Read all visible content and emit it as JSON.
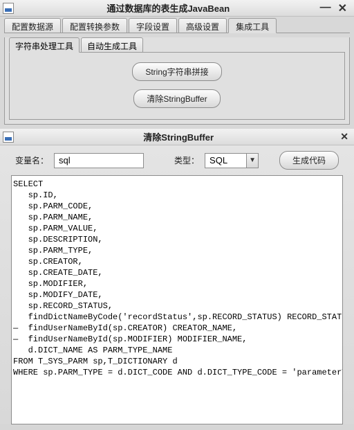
{
  "title": "通过数据库的表生成JavaBean",
  "window_buttons": {
    "min": "—",
    "close": "✕"
  },
  "main_tabs": [
    {
      "label": "配置数据源",
      "active": false
    },
    {
      "label": "配置转换参数",
      "active": false
    },
    {
      "label": "字段设置",
      "active": false
    },
    {
      "label": "高级设置",
      "active": false
    },
    {
      "label": "集成工具",
      "active": true
    }
  ],
  "sub_tabs": [
    {
      "label": "字符串处理工具",
      "active": true
    },
    {
      "label": "自动生成工具",
      "active": false
    }
  ],
  "buttons": {
    "string_concat": "String字符串拼接",
    "clear_stringbuffer": "清除StringBuffer"
  },
  "inner_title": "清除StringBuffer",
  "form": {
    "var_label": "变量名：",
    "var_value": "sql",
    "type_label": "类型：",
    "type_value": "SQL",
    "gen_label": "生成代码"
  },
  "editor_text": "SELECT\n   sp.ID,\n   sp.PARM_CODE,\n   sp.PARM_NAME,\n   sp.PARM_VALUE,\n   sp.DESCRIPTION,\n   sp.PARM_TYPE,\n   sp.CREATOR,\n   sp.CREATE_DATE,\n   sp.MODIFIER,\n   sp.MODIFY_DATE,\n   sp.RECORD_STATUS,\n   findDictNameByCode('recordStatus',sp.RECORD_STATUS) RECORD_STATUS_NAME,\n—  findUserNameById(sp.CREATOR) CREATOR_NAME,\n—  findUserNameById(sp.MODIFIER) MODIFIER_NAME,\n   d.DICT_NAME AS PARM_TYPE_NAME\nFROM T_SYS_PARM sp,T_DICTIONARY d\nWHERE sp.PARM_TYPE = d.DICT_CODE AND d.DICT_TYPE_CODE = 'parameterType'"
}
